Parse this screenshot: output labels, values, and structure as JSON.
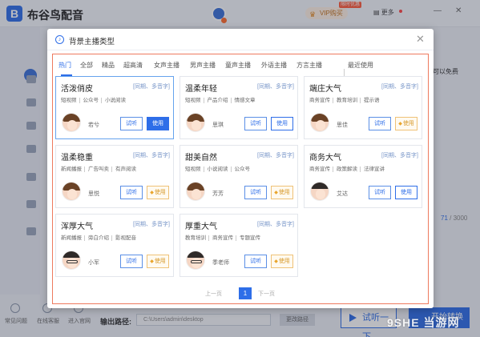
{
  "app": {
    "title": "布谷鸟配音",
    "vip_label": "VIP购买",
    "vip_tag": "限时优惠",
    "more_label": "更多"
  },
  "background": {
    "right_text": "可以免费",
    "count_current": "71",
    "count_total": "/ 3000",
    "footer": {
      "items": [
        "常见问题",
        "在线客服",
        "进入官网"
      ],
      "output_label": "输出路径:",
      "output_path": "C:\\Users\\admin\\desktop",
      "change_path": "更改路径",
      "listen_button": "试听一下",
      "convert_button": "开始转换"
    },
    "watermark": "9SHE 当游网"
  },
  "modal": {
    "title": "背景主播类型",
    "tabs": [
      "热门",
      "全部",
      "精品",
      "超高清",
      "女声主播",
      "男声主播",
      "童声主播",
      "外语主播",
      "方言主播",
      "最近使用"
    ],
    "active_tab": 0,
    "cards": [
      {
        "name": "活泼俏皮",
        "badge": "[同期、多音字]",
        "tags": [
          "短视频",
          "公众号",
          "小说阅读"
        ],
        "voice": "若兮",
        "listen": "试听",
        "use": "使用",
        "use_style": "primary",
        "avatar": "f"
      },
      {
        "name": "温柔年轻",
        "badge": "[同期、多音字]",
        "tags": [
          "短视频",
          "产品介绍",
          "情感文章"
        ],
        "voice": "思琪",
        "listen": "试听",
        "use": "使用",
        "use_style": "normal",
        "avatar": "f"
      },
      {
        "name": "端庄大气",
        "badge": "[同期、多音字]",
        "tags": [
          "商务宣传",
          "教育培训",
          "提示语"
        ],
        "voice": "思佳",
        "listen": "试听",
        "use": "使用",
        "use_style": "vip",
        "avatar": "f"
      },
      {
        "name": "温柔稳重",
        "badge": "[同期、多音字]",
        "tags": [
          "新闻播报",
          "广告叫卖",
          "有声阅读"
        ],
        "voice": "思悦",
        "listen": "试听",
        "use": "使用",
        "use_style": "vip",
        "avatar": "f"
      },
      {
        "name": "甜美自然",
        "badge": "[同期、多音字]",
        "tags": [
          "短视频",
          "小说阅读",
          "公众号"
        ],
        "voice": "芳芳",
        "listen": "试听",
        "use": "使用",
        "use_style": "vip",
        "avatar": "f"
      },
      {
        "name": "商务大气",
        "badge": "[同期、多音字]",
        "tags": [
          "商务宣传",
          "政策解读",
          "法律宣讲"
        ],
        "voice": "艾达",
        "listen": "试听",
        "use": "使用",
        "use_style": "normal",
        "avatar": "m"
      },
      {
        "name": "浑厚大气",
        "badge": "[同期、多音字]",
        "tags": [
          "新闻播报",
          "旁白介绍",
          "影视配音"
        ],
        "voice": "小军",
        "listen": "试听",
        "use": "使用",
        "use_style": "vip",
        "avatar": "g"
      },
      {
        "name": "厚重大气",
        "badge": "[同期、多音字]",
        "tags": [
          "教育培训",
          "商务宣传",
          "专题宣传"
        ],
        "voice": "季老师",
        "listen": "试听",
        "use": "使用",
        "use_style": "vip",
        "avatar": "g"
      }
    ],
    "pager": {
      "prev": "上一页",
      "current": "1",
      "next": "下一页"
    }
  }
}
